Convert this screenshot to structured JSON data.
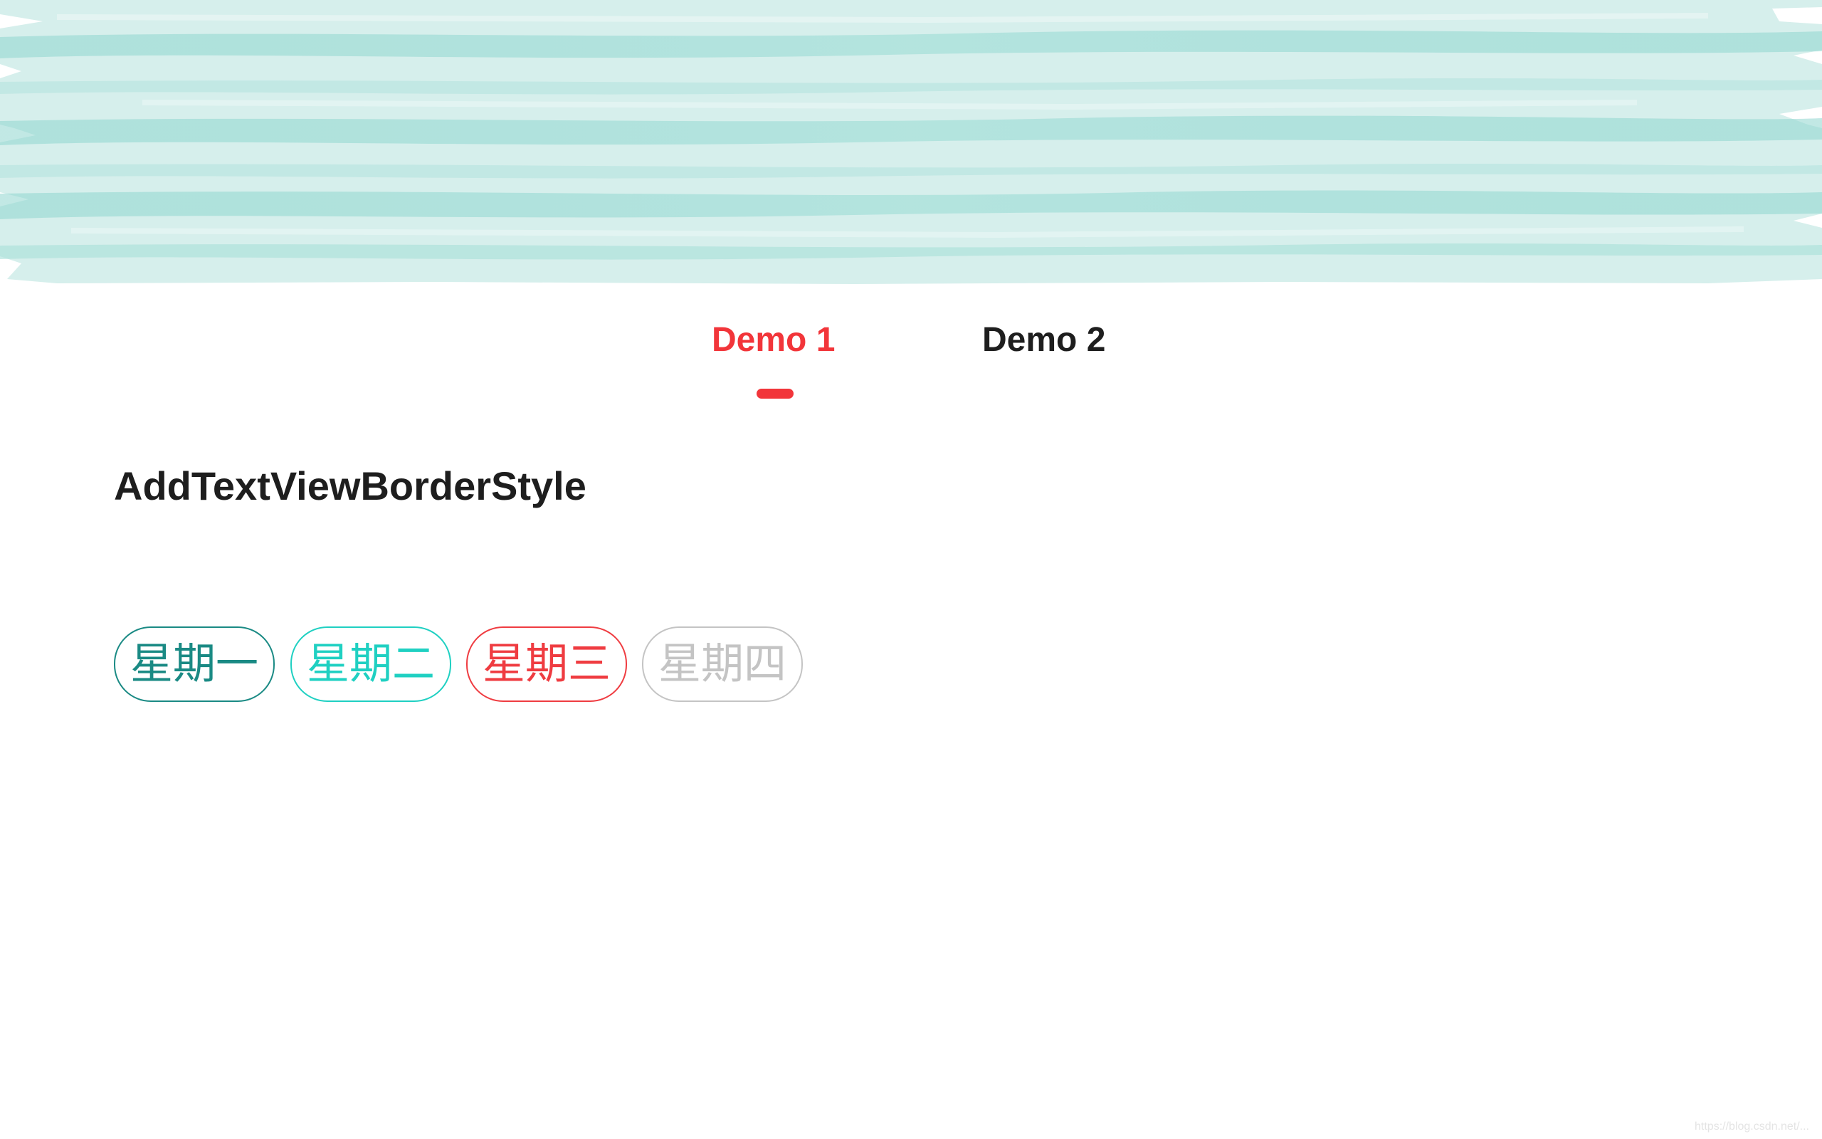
{
  "tabs": [
    {
      "label": "Demo 1",
      "active": true
    },
    {
      "label": "Demo 2",
      "active": false
    }
  ],
  "section": {
    "title": "AddTextViewBorderStyle"
  },
  "chips": [
    {
      "label": "星期一",
      "color": "#1a8a84"
    },
    {
      "label": "星期二",
      "color": "#1fd0c2"
    },
    {
      "label": "星期三",
      "color": "#ef3c41"
    },
    {
      "label": "星期四",
      "color": "#c4c4c4"
    }
  ],
  "colors": {
    "accent": "#f2353a",
    "banner_base": "#d4efed",
    "banner_stroke": "#9edcd6",
    "text_dark": "#1e1e1e"
  },
  "watermark": "https://blog.csdn.net/..."
}
